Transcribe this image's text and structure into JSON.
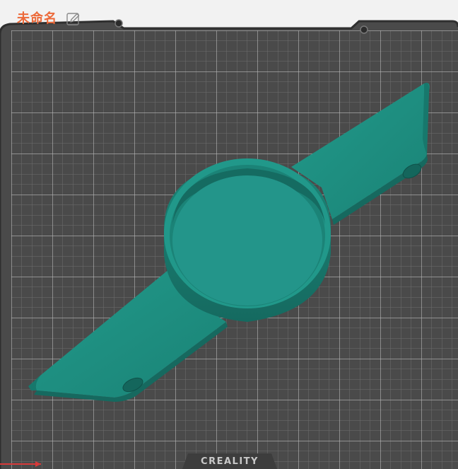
{
  "project": {
    "title": "未命名",
    "edit_icon": "pencil-icon"
  },
  "bed": {
    "brand_label": "CREALITY"
  },
  "colors": {
    "title": "#ec6a3a",
    "plate": "#4a4a4a",
    "grid_minor": "#6e6e6e",
    "grid_major": "#b5b5b5",
    "model": "#1e9081",
    "model_top": "#239487",
    "model_shadow": "#16695f",
    "axis_x": "#d83a3a"
  }
}
